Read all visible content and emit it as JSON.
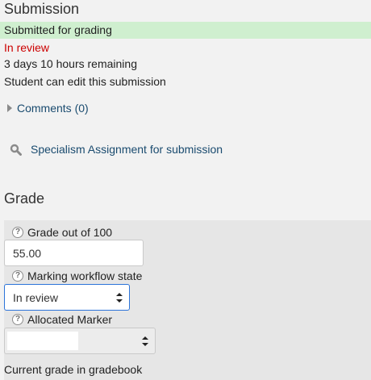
{
  "submission": {
    "heading": "Submission",
    "status": "Submitted for grading",
    "review_status": "In review",
    "time_remaining": "3 days 10 hours remaining",
    "edit_permission": "Student can edit this submission",
    "comments_label": "Comments (0)",
    "file_link": "Specialism Assignment for submission"
  },
  "grade": {
    "heading": "Grade",
    "grade_label": "Grade out of 100",
    "grade_value": "55.00",
    "workflow_label": "Marking workflow state",
    "workflow_value": "In review",
    "marker_label": "Allocated Marker",
    "marker_value": "",
    "current_grade_label": "Current grade in gradebook"
  },
  "colors": {
    "status_bg": "#cfefcf",
    "review_text": "#cc0000",
    "link_text": "#1a4b6f",
    "focus_border": "#2c74d9"
  },
  "icons": {
    "help": "question-circle-icon",
    "search": "magnifier-icon",
    "collapsed": "triangle-right-icon"
  }
}
